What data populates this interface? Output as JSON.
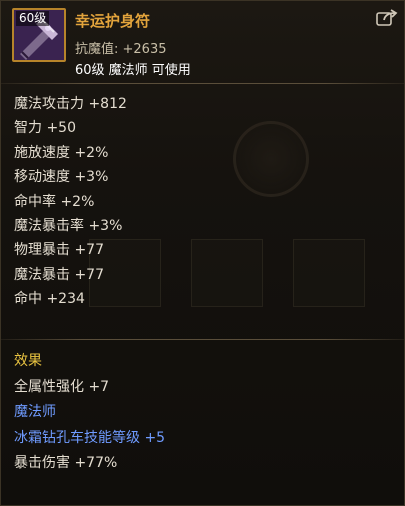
{
  "item": {
    "level_badge": "60级",
    "name": "幸运护身符",
    "resist": "抗魔值: +2635",
    "usable": "60级 魔法师 可使用"
  },
  "stats": [
    "魔法攻击力 +812",
    "智力 +50",
    "施放速度 +2%",
    "移动速度 +3%",
    "命中率 +2%",
    "魔法暴击率 +3%",
    "物理暴击 +77",
    "魔法暴击 +77",
    "命中 +234"
  ],
  "effects": {
    "title": "效果",
    "lines": [
      {
        "text": "全属性强化 +7",
        "color": "white"
      },
      {
        "text": "魔法师",
        "color": "blue"
      },
      {
        "text": "冰霜钻孔车技能等级 +5",
        "color": "blue"
      },
      {
        "text": "暴击伤害 +77%",
        "color": "white"
      }
    ]
  },
  "colors": {
    "item_name": "#e3a43c",
    "effects_title": "#e9c441",
    "stat_text": "#e4ddd0",
    "class_skill": "#6f9bff",
    "icon_border": "#b7842a"
  },
  "icons": {
    "item": "amulet-item-icon",
    "share": "share-icon"
  }
}
